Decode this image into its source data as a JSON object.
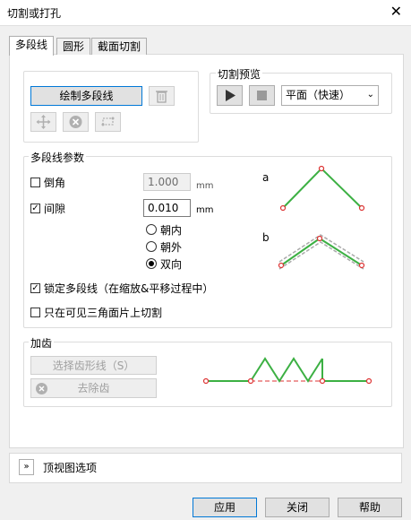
{
  "window": {
    "title": "切割或打孔",
    "close_glyph": "✕"
  },
  "tabs": [
    "多段线",
    "圆形",
    "截面切割"
  ],
  "top_left": {
    "draw_button": "绘制多段线"
  },
  "preview": {
    "title": "切割预览",
    "mode": "平面（快速）"
  },
  "params": {
    "title": "多段线参数",
    "chamfer": {
      "label": "倒角",
      "value": "1.000",
      "unit": "mm"
    },
    "gap": {
      "label": "间隙",
      "value": "0.010",
      "unit": "mm"
    },
    "directions": [
      "朝内",
      "朝外",
      "双向"
    ],
    "lock_label": "锁定多段线（在缩放&平移过程中）",
    "visible_label": "只在可见三角面片上切割",
    "diagram_a": "a",
    "diagram_b": "b"
  },
  "teeth": {
    "title": "加齿",
    "select_button": "选择齿形线（S）",
    "remove_button": "去除齿"
  },
  "bottom": {
    "top_view_label": "顶视图选项"
  },
  "footer": {
    "apply": "应用",
    "close": "关闭",
    "help": "帮助"
  }
}
